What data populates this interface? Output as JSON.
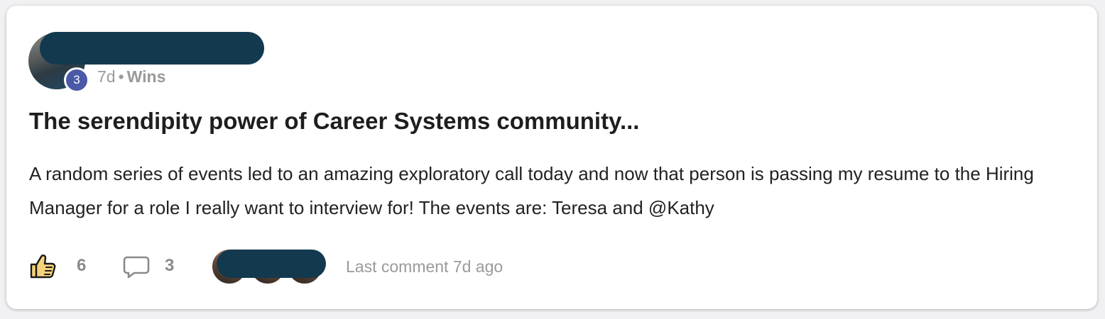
{
  "post": {
    "author": {
      "level_badge": "3"
    },
    "time_ago": "7d",
    "separator": "•",
    "category": "Wins",
    "title": "The serendipity power of Career Systems community...",
    "body": "A random series of events led to an amazing exploratory call today and now that person is passing my resume to the Hiring Manager for a role I really want to interview for! The events are: Teresa and @Kathy",
    "likes": "6",
    "comments": "3",
    "last_comment": "Last comment 7d ago"
  },
  "colors": {
    "badge": "#4a59a8",
    "redaction": "#13394f",
    "like_fill": "#f7d27a"
  },
  "icons": [
    "thumbs-up-icon",
    "comment-bubble-icon"
  ]
}
